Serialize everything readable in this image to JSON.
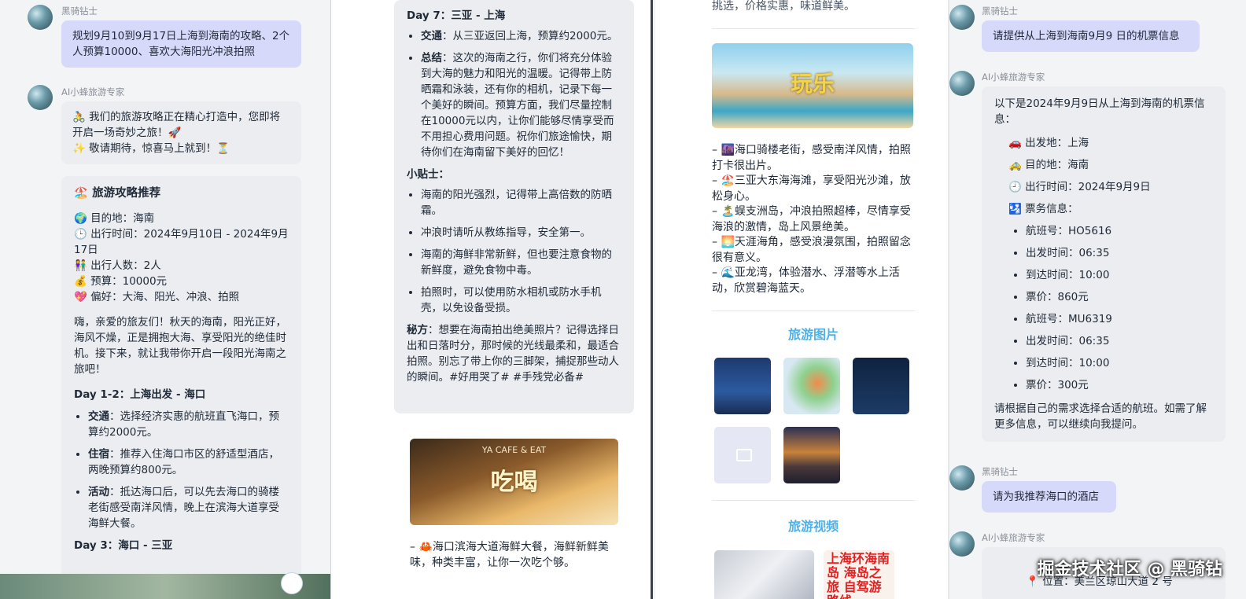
{
  "user_name": "黑骑钻士",
  "ai_name": "AI小蜂旅游专家",
  "panel1": {
    "user_msg": "规划9月10到9月17日上海到海南的攻略、2个人预算10000、喜欢大海阳光冲浪拍照",
    "ai_msg_line1": "🚴 我们的旅游攻略正在精心打造中，您即将开启一场奇妙之旅！🚀",
    "ai_msg_line2": "✨ 敬请期待，惊喜马上就到！⏳",
    "card_title": "🏖️ 旅游攻略推荐",
    "info": [
      "🌍 目的地：海南",
      "🕒 出行时间：2024年9月10日 - 2024年9月17日",
      "👫 出行人数：2人",
      "💰 预算：10000元",
      "💖 偏好：大海、阳光、冲浪、拍照"
    ],
    "intro": "嗨，亲爱的旅友们！秋天的海南，阳光正好，海风不燥，正是拥抱大海、享受阳光的绝佳时机。接下来，就让我带你开启一段阳光海南之旅吧！",
    "day12_title": "Day 1-2：上海出发 - 海口",
    "day12": [
      {
        "k": "交通",
        "v": "：选择经济实惠的航班直飞海口，预算约2000元。"
      },
      {
        "k": "住宿",
        "v": "：推荐入住海口市区的舒适型酒店，两晚预算约800元。"
      },
      {
        "k": "活动",
        "v": "：抵达海口后，可以先去海口的骑楼老街感受南洋风情，晚上在滨海大道享受海鲜大餐。"
      }
    ],
    "day3_title": "Day 3：海口 - 三亚"
  },
  "panel2": {
    "day7_title": "Day 7：三亚 - 上海",
    "day7": [
      {
        "k": "交通",
        "v": "：从三亚返回上海，预算约2000元。"
      },
      {
        "k": "总结",
        "v": "：这次的海南之行，你们将充分体验到大海的魅力和阳光的温暖。记得带上防晒霜和泳装，还有你的相机，记录下每一个美好的瞬间。预算方面，我们尽量控制在10000元以内，让你们能够尽情享受而不用担心费用问题。祝你们旅途愉快，期待你们在海南留下美好的回忆！"
      }
    ],
    "tips_title": "小贴士：",
    "tips": [
      "海南的阳光强烈，记得带上高倍数的防晒霜。",
      "冲浪时请听从教练指导，安全第一。",
      "海南的海鲜非常新鲜，但也要注意食物的新鲜度，避免食物中毒。",
      "拍照时，可以使用防水相机或防水手机壳，以免设备受损。"
    ],
    "secret_k": "秘方",
    "secret_v": "：想要在海南拍出绝美照片？记得选择日出和日落时分，那时候的光线最柔和，最适合拍照。别忘了带上你的三脚架，捕捉那些动人的瞬间。#好用哭了# #手残党必备#",
    "food_sign": "YA CAFE & EAT",
    "food_title": "吃喝",
    "food_text": "– 🦀海口滨海大道海鲜大餐，海鲜新鲜美味，种类丰富，让你一次吃个够。"
  },
  "panel3": {
    "top_text": "挑选，价格实惠，味道鲜美。",
    "fun_title": "玩乐",
    "fun_items": [
      "– 🌆海口骑楼老街，感受南洋风情，拍照打卡很出片。",
      "– 🏖️三亚大东海海滩，享受阳光沙滩，放松身心。",
      "– 🏝️蜈支洲岛，冲浪拍照超棒，尽情享受海浪的激情，岛上风景绝美。",
      "– 🌅天涯海角，感受浪漫氛围，拍照留念很有意义。",
      "– 🌊亚龙湾，体验潜水、浮潜等水上活动，欣赏碧海蓝天。"
    ],
    "photos_title": "旅游图片",
    "videos_title": "旅游视频",
    "video2_text": "上海环海南岛 海岛之旅 自驾游路线"
  },
  "panel4": {
    "user_msg1": "请提供从上海到海南9月9 日的机票信息",
    "flight_intro": "以下是2024年9月9日从上海到海南的机票信息：",
    "flight_info": [
      "🚗 出发地：上海",
      "🚕 目的地：海南",
      "🕘 出行时间：2024年9月9日",
      "🛂 票务信息："
    ],
    "flights": [
      "航班号：HO5616",
      "出发时间：06:35",
      "到达时间：10:00",
      "票价：860元",
      "航班号：MU6319",
      "出发时间：06:35",
      "到达时间：10:00",
      "票价：300元"
    ],
    "flight_outro": "请根据自己的需求选择合适的航班。如需了解更多信息，可以继续向我提问。",
    "user_msg2": "请为我推荐海口的酒店",
    "hotel_line": "📍 位置：美兰区琼山大道 2 号"
  },
  "watermark": "掘金技术社区 @ 黑骑钻"
}
